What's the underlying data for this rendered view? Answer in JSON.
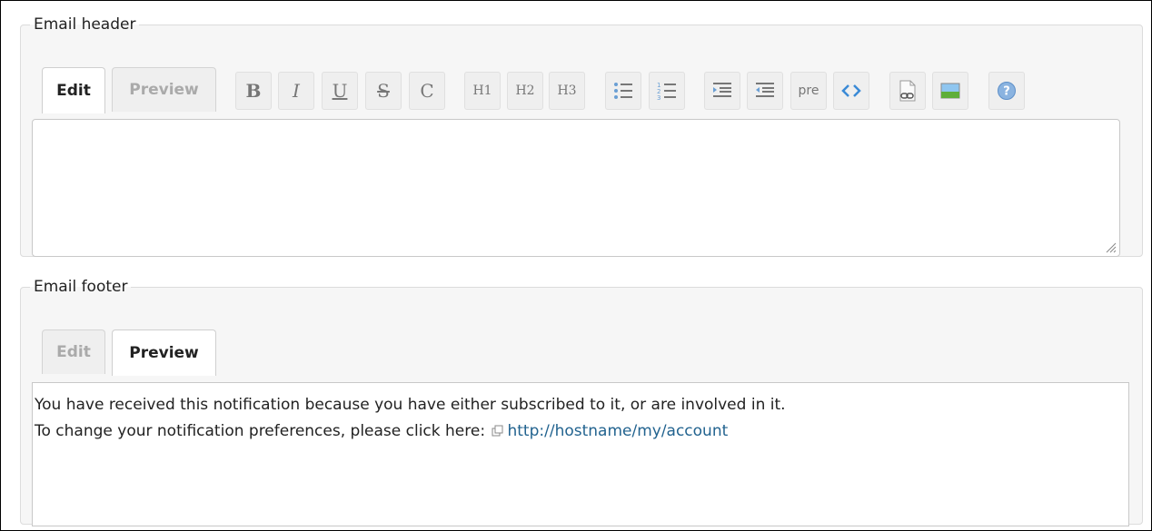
{
  "header_section": {
    "legend": "Email header",
    "tabs": {
      "edit": "Edit",
      "preview": "Preview"
    },
    "toolbar": {
      "bold": "B",
      "italic": "I",
      "underline": "U",
      "strike": "S",
      "code": "C",
      "h1": "H1",
      "h2": "H2",
      "h3": "H3",
      "pre": "pre"
    },
    "textarea_value": ""
  },
  "footer_section": {
    "legend": "Email footer",
    "tabs": {
      "edit": "Edit",
      "preview": "Preview"
    },
    "preview_line1": "You have received this notification because you have either subscribed to it, or are involved in it.",
    "preview_line2": "To change your notification preferences, please click here:",
    "preview_link": "http://hostname/my/account"
  },
  "colors": {
    "link": "#22638f",
    "panel": "#f6f6f6",
    "toolbar_button": "#efefef"
  }
}
